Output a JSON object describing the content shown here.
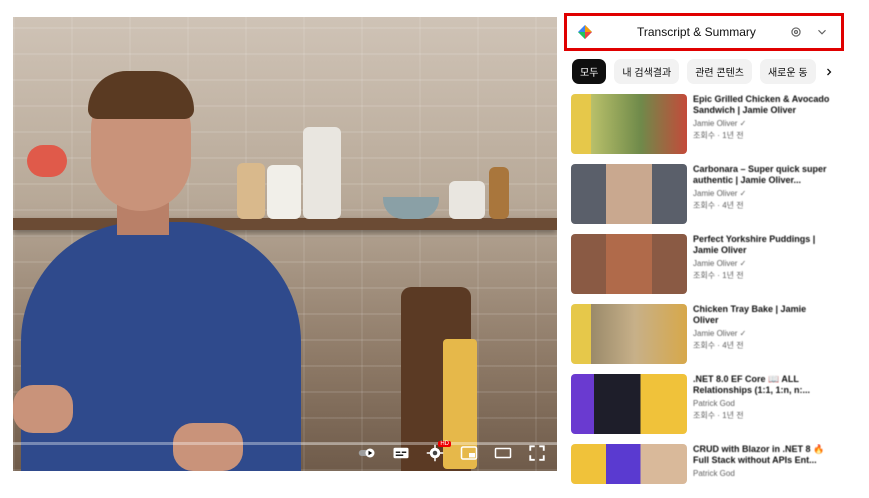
{
  "player": {
    "controls": [
      {
        "name": "autoplay-toggle",
        "icon": "autoplay-icon"
      },
      {
        "name": "subtitles-button",
        "icon": "subtitles-icon"
      },
      {
        "name": "settings-button",
        "icon": "gear-icon",
        "badge": "HD"
      },
      {
        "name": "miniplayer-button",
        "icon": "miniplayer-icon"
      },
      {
        "name": "theater-button",
        "icon": "theater-icon"
      },
      {
        "name": "fullscreen-button",
        "icon": "fullscreen-icon"
      }
    ]
  },
  "extension": {
    "title": "Transcript & Summary",
    "icons": [
      "logo-icon",
      "gear-icon",
      "chevron-down-icon"
    ]
  },
  "chips": [
    "모두",
    "내 검색결과",
    "관련 콘텐츠",
    "새로운 동"
  ],
  "recommendations": [
    {
      "title": "Epic Grilled Chicken & Avocado Sandwich | Jamie Oliver",
      "channel": "Jamie Oliver ✓",
      "stats": "조회수 · 1년 전"
    },
    {
      "title": "Carbonara – Super quick super authentic | Jamie Oliver...",
      "channel": "Jamie Oliver ✓",
      "stats": "조회수 · 4년 전"
    },
    {
      "title": "Perfect Yorkshire Puddings | Jamie Oliver",
      "channel": "Jamie Oliver ✓",
      "stats": "조회수 · 1년 전"
    },
    {
      "title": "Chicken Tray Bake | Jamie Oliver",
      "channel": "Jamie Oliver ✓",
      "stats": "조회수 · 4년 전"
    },
    {
      "title": ".NET 8.0 EF Core 📖 ALL Relationships (1:1, 1:n, n:...",
      "channel": "Patrick God",
      "stats": "조회수 · 1년 전"
    },
    {
      "title": "CRUD with Blazor in .NET 8 🔥 Full Stack without APIs Ent...",
      "channel": "Patrick God",
      "stats": ""
    }
  ],
  "colors": {
    "highlight": "#e00000",
    "chip_active": "#0f0f0f"
  }
}
